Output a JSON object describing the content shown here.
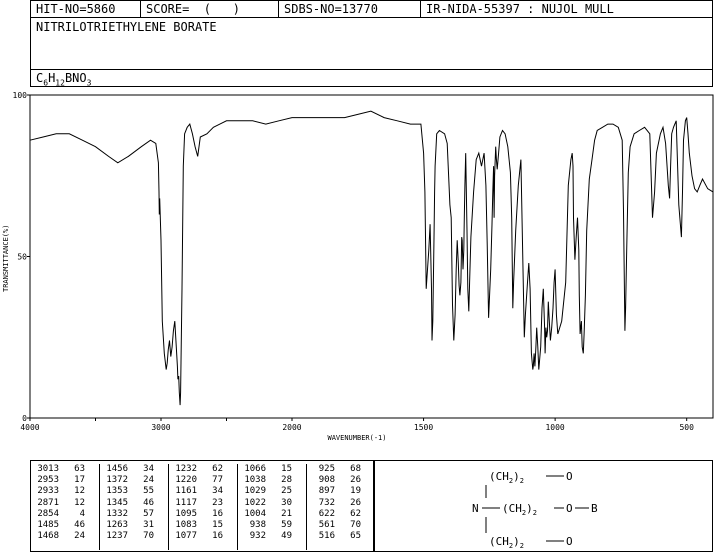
{
  "header": {
    "hit_no": "HIT-NO=5860",
    "score": "SCORE=  (   )",
    "sdbs_no": "SDBS-NO=13770",
    "ir_nida": "IR-NIDA-55397 : NUJOL MULL"
  },
  "compound_name": "NITRILOTRIETHYLENE BORATE",
  "formula": {
    "c": "C",
    "c_sub": "6",
    "h": "H",
    "h_sub": "12",
    "bno": "BNO",
    "o_sub": "3"
  },
  "chart_data": {
    "type": "line",
    "xlabel": "WAVENUMBER(-1)",
    "ylabel": "TRANSMITTANCE(%)",
    "xlim": [
      4000,
      400
    ],
    "ylim": [
      0,
      100
    ],
    "x_ticks": [
      "4000",
      "3000",
      "2000",
      "1500",
      "1000",
      "500"
    ],
    "y_ticks": [
      "100",
      "50",
      "0"
    ],
    "series": [
      {
        "x": [
          4000,
          3900,
          3800,
          3700,
          3600,
          3500,
          3400,
          3330,
          3250,
          3150,
          3080,
          3040,
          3020,
          3015,
          3013,
          3010,
          3000,
          2990,
          2975,
          2960,
          2953,
          2945,
          2935,
          2925,
          2915,
          2905,
          2895,
          2885,
          2875,
          2871,
          2865,
          2860,
          2854,
          2850,
          2840,
          2830,
          2820,
          2800,
          2780,
          2760,
          2740,
          2720,
          2700,
          2650,
          2600,
          2550,
          2500,
          2400,
          2300,
          2200,
          2100,
          2000,
          1900,
          1800,
          1750,
          1700,
          1650,
          1600,
          1550,
          1510,
          1500,
          1495,
          1490,
          1485,
          1480,
          1475,
          1470,
          1468,
          1465,
          1460,
          1458,
          1456,
          1450,
          1440,
          1420,
          1410,
          1400,
          1395,
          1390,
          1385,
          1380,
          1376,
          1372,
          1368,
          1365,
          1362,
          1358,
          1355,
          1353,
          1350,
          1347,
          1345,
          1343,
          1340,
          1335,
          1332,
          1328,
          1325,
          1320,
          1310,
          1300,
          1290,
          1280,
          1270,
          1263,
          1258,
          1253,
          1250,
          1245,
          1240,
          1237,
          1234,
          1232,
          1230,
          1226,
          1223,
          1220,
          1215,
          1210,
          1200,
          1190,
          1180,
          1170,
          1165,
          1161,
          1158,
          1150,
          1140,
          1130,
          1120,
          1117,
          1113,
          1105,
          1100,
          1095,
          1090,
          1085,
          1083,
          1080,
          1077,
          1073,
          1070,
          1066,
          1062,
          1055,
          1050,
          1045,
          1040,
          1038,
          1035,
          1032,
          1029,
          1026,
          1022,
          1018,
          1013,
          1008,
          1004,
          1000,
          995,
          990,
          975,
          960,
          950,
          940,
          935,
          932,
          930,
          925,
          920,
          915,
          910,
          908,
          905,
          900,
          897,
          893,
          890,
          885,
          880,
          870,
          860,
          850,
          840,
          820,
          800,
          780,
          760,
          745,
          740,
          735,
          732,
          728,
          722,
          715,
          700,
          680,
          660,
          640,
          630,
          622,
          615,
          600,
          590,
          580,
          570,
          565,
          561,
          557,
          550,
          540,
          530,
          520,
          516,
          512,
          505,
          500,
          495,
          490,
          480,
          470,
          460,
          450,
          440,
          420,
          400
        ],
        "y": [
          86,
          87,
          88,
          88,
          86,
          84,
          81,
          79,
          81,
          84,
          86,
          85,
          79,
          70,
          63,
          68,
          55,
          30,
          20,
          15,
          17,
          21,
          24,
          19,
          22,
          27,
          30,
          23,
          16,
          12,
          13,
          8,
          4,
          8,
          40,
          78,
          88,
          90,
          91,
          88,
          84,
          81,
          87,
          88,
          90,
          91,
          92,
          92,
          92,
          91,
          92,
          93,
          93,
          93,
          94,
          95,
          93,
          92,
          91,
          91,
          82,
          70,
          40,
          46,
          52,
          60,
          40,
          24,
          30,
          58,
          70,
          78,
          88,
          89,
          88,
          85,
          66,
          62,
          35,
          24,
          32,
          46,
          55,
          48,
          41,
          38,
          42,
          56,
          55,
          46,
          52,
          62,
          72,
          82,
          58,
          40,
          33,
          42,
          56,
          70,
          80,
          82,
          78,
          82,
          72,
          54,
          31,
          36,
          46,
          60,
          70,
          78,
          62,
          75,
          84,
          80,
          77,
          82,
          87,
          89,
          88,
          84,
          76,
          62,
          34,
          42,
          58,
          72,
          80,
          38,
          25,
          32,
          42,
          48,
          40,
          20,
          15,
          16,
          20,
          16,
          22,
          28,
          22,
          15,
          22,
          34,
          40,
          28,
          20,
          28,
          25,
          27,
          36,
          30,
          24,
          28,
          34,
          42,
          46,
          32,
          26,
          30,
          42,
          72,
          80,
          82,
          78,
          62,
          49,
          56,
          62,
          52,
          38,
          26,
          30,
          22,
          20,
          26,
          38,
          58,
          74,
          80,
          86,
          89,
          90,
          91,
          91,
          90,
          86,
          64,
          27,
          34,
          52,
          76,
          84,
          88,
          89,
          90,
          88,
          62,
          70,
          82,
          88,
          90,
          85,
          72,
          68,
          78,
          88,
          90,
          92,
          66,
          56,
          70,
          86,
          92,
          93,
          88,
          82,
          75,
          71,
          70,
          72,
          74,
          71,
          70
        ]
      }
    ]
  },
  "peak_table": [
    [
      [
        "3013",
        "63"
      ],
      [
        "2953",
        "17"
      ],
      [
        "2933",
        "12"
      ],
      [
        "2871",
        "12"
      ],
      [
        "2854",
        "4"
      ],
      [
        "1485",
        "46"
      ],
      [
        "1468",
        "24"
      ]
    ],
    [
      [
        "1456",
        "34"
      ],
      [
        "1372",
        "24"
      ],
      [
        "1353",
        "55"
      ],
      [
        "1345",
        "46"
      ],
      [
        "1332",
        "57"
      ],
      [
        "1263",
        "31"
      ],
      [
        "1237",
        "70"
      ]
    ],
    [
      [
        "1232",
        "62"
      ],
      [
        "1220",
        "77"
      ],
      [
        "1161",
        "34"
      ],
      [
        "1117",
        "23"
      ],
      [
        "1095",
        "16"
      ],
      [
        "1083",
        "15"
      ],
      [
        "1077",
        "16"
      ]
    ],
    [
      [
        "1066",
        "15"
      ],
      [
        "1038",
        "28"
      ],
      [
        "1029",
        "25"
      ],
      [
        "1022",
        "30"
      ],
      [
        "1004",
        "21"
      ],
      [
        "938",
        "59"
      ],
      [
        "932",
        "49"
      ]
    ],
    [
      [
        "925",
        "68"
      ],
      [
        "908",
        "26"
      ],
      [
        "897",
        "19"
      ],
      [
        "732",
        "26"
      ],
      [
        "622",
        "62"
      ],
      [
        "561",
        "70"
      ],
      [
        "516",
        "65"
      ]
    ]
  ],
  "structure": {
    "ch2_a": "(CH",
    "sub_a": "2",
    "tail_a": ")",
    "idx_a": "2",
    "o1": "O",
    "n": "N",
    "o2": "O",
    "b": "B",
    "o3": "O"
  }
}
